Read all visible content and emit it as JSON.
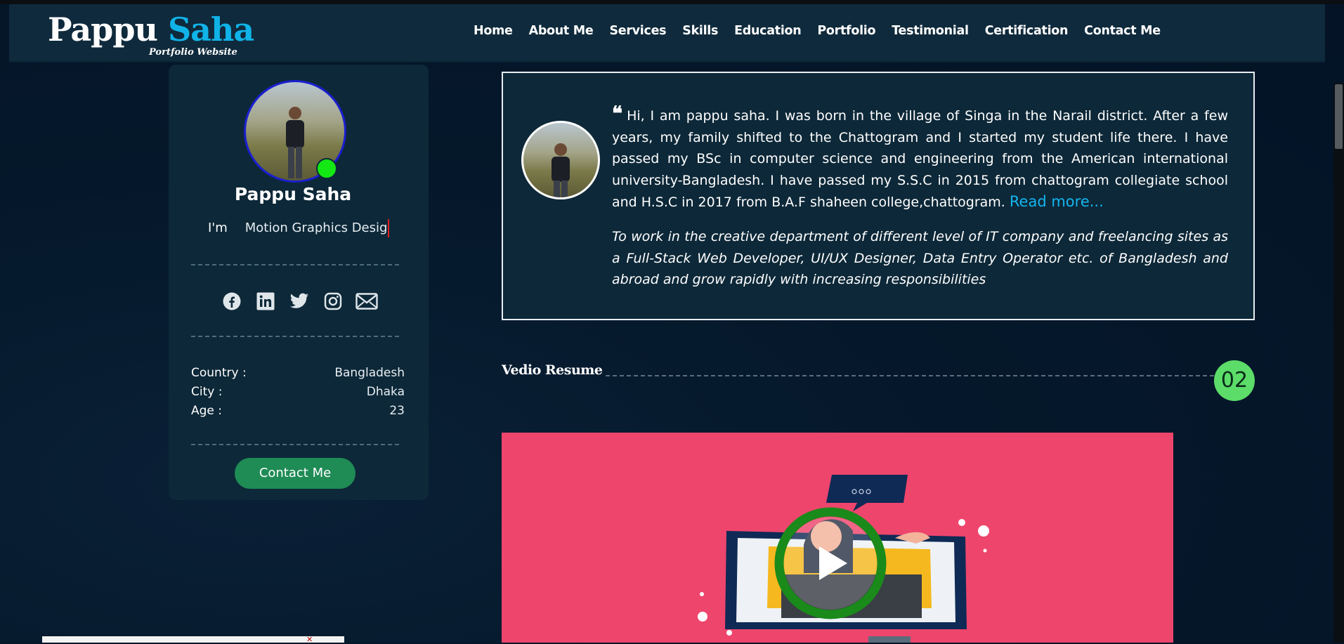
{
  "brand": {
    "first": "Pappu",
    "last": "Saha",
    "tagline": "Portfolio Website"
  },
  "nav": {
    "items": [
      "Home",
      "About Me",
      "Services",
      "Skills",
      "Education",
      "Portfolio",
      "Testimonial",
      "Certification",
      "Contact Me"
    ]
  },
  "profile": {
    "name": "Pappu Saha",
    "typed_prefix": "I'm",
    "typed_text": "Motion Graphics Desig",
    "social_icons": [
      "facebook-icon",
      "linkedin-icon",
      "twitter-icon",
      "instagram-icon",
      "mail-icon"
    ],
    "info": [
      {
        "label": "Country :",
        "value": "Bangladesh"
      },
      {
        "label": "City :",
        "value": "Dhaka"
      },
      {
        "label": "Age :",
        "value": "23"
      }
    ],
    "contact_button": "Contact Me",
    "status_color": "#14e814"
  },
  "about": {
    "bio": "Hi, I am pappu saha. I was born in the village of Singa in the Narail district. After a few years, my family shifted to the Chattogram and I started my student life there. I have passed my BSc in computer science and engineering from the American international university-Bangladesh. I have passed my S.S.C in 2015 from chattogram collegiate school and H.S.C in 2017 from B.A.F shaheen college,chattogram.",
    "read_more": "Read more...",
    "objective": "To work in the creative department of different level of IT company and freelancing sites as a Full-Stack Web Developer, UI/UX Designer, Data Entry Operator etc. of Bangladesh and abroad and grow rapidly with increasing responsibilities"
  },
  "video_section": {
    "title": "Vedio Resume",
    "number": "02",
    "play_icon": "play-icon",
    "panel_color": "#ee456d"
  },
  "colors": {
    "accent": "#10b3e8",
    "button": "#1f8b55",
    "badge": "#5cdc68"
  }
}
